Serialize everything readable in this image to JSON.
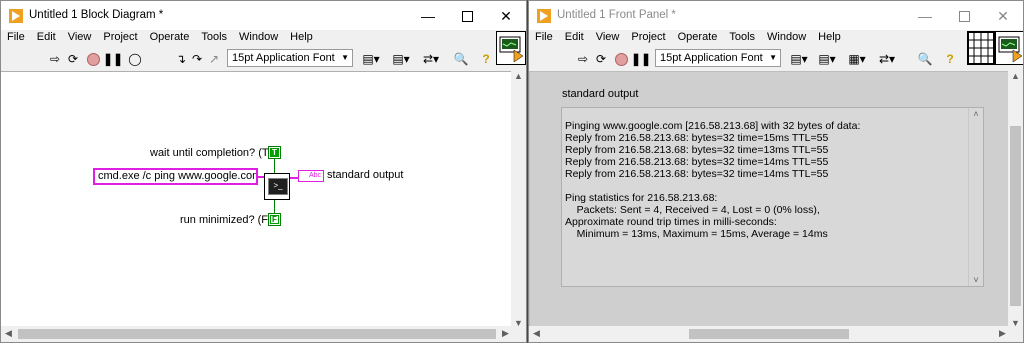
{
  "colors": {
    "labview_orange": "#f0a020",
    "string_wire": "#e020e0",
    "boolean_wire": "#008000",
    "panel_bg": "#cfcfcf",
    "desktop": "#6b3b2a"
  },
  "block_diagram": {
    "title": "Untitled 1 Block Diagram *",
    "menu": [
      "File",
      "Edit",
      "View",
      "Project",
      "Operate",
      "Tools",
      "Window",
      "Help"
    ],
    "font_select": "15pt Application Font",
    "wait_label": "wait until completion? (T)",
    "wait_const": "T",
    "command": "cmd.exe /c ping www.google.com",
    "indicator_glyph": "Abc",
    "stdout_label": "standard output",
    "minimized_label": "run minimized? (F)",
    "minimized_const": "F",
    "icons": [
      "run-arrow-icon",
      "run-continuously-icon",
      "abort-icon",
      "pause-icon",
      "highlight-execution-icon",
      "retain-wire-values-icon",
      "step-into-icon",
      "step-over-icon",
      "step-out-icon",
      "align-icon",
      "distribute-icon",
      "reorder-icon",
      "cleanup-icon",
      "search-icon",
      "help-icon"
    ]
  },
  "front_panel": {
    "title": "Untitled 1 Front Panel *",
    "menu": [
      "File",
      "Edit",
      "View",
      "Project",
      "Operate",
      "Tools",
      "Window",
      "Help"
    ],
    "font_select": "15pt Application Font",
    "indicator_label": "standard output",
    "output_text": "Pinging www.google.com [216.58.213.68] with 32 bytes of data:\nReply from 216.58.213.68: bytes=32 time=15ms TTL=55\nReply from 216.58.213.68: bytes=32 time=13ms TTL=55\nReply from 216.58.213.68: bytes=32 time=14ms TTL=55\nReply from 216.58.213.68: bytes=32 time=14ms TTL=55\n\nPing statistics for 216.58.213.68:\n    Packets: Sent = 4, Received = 4, Lost = 0 (0% loss),\nApproximate round trip times in milli-seconds:\n    Minimum = 13ms, Maximum = 15ms, Average = 14ms"
  }
}
